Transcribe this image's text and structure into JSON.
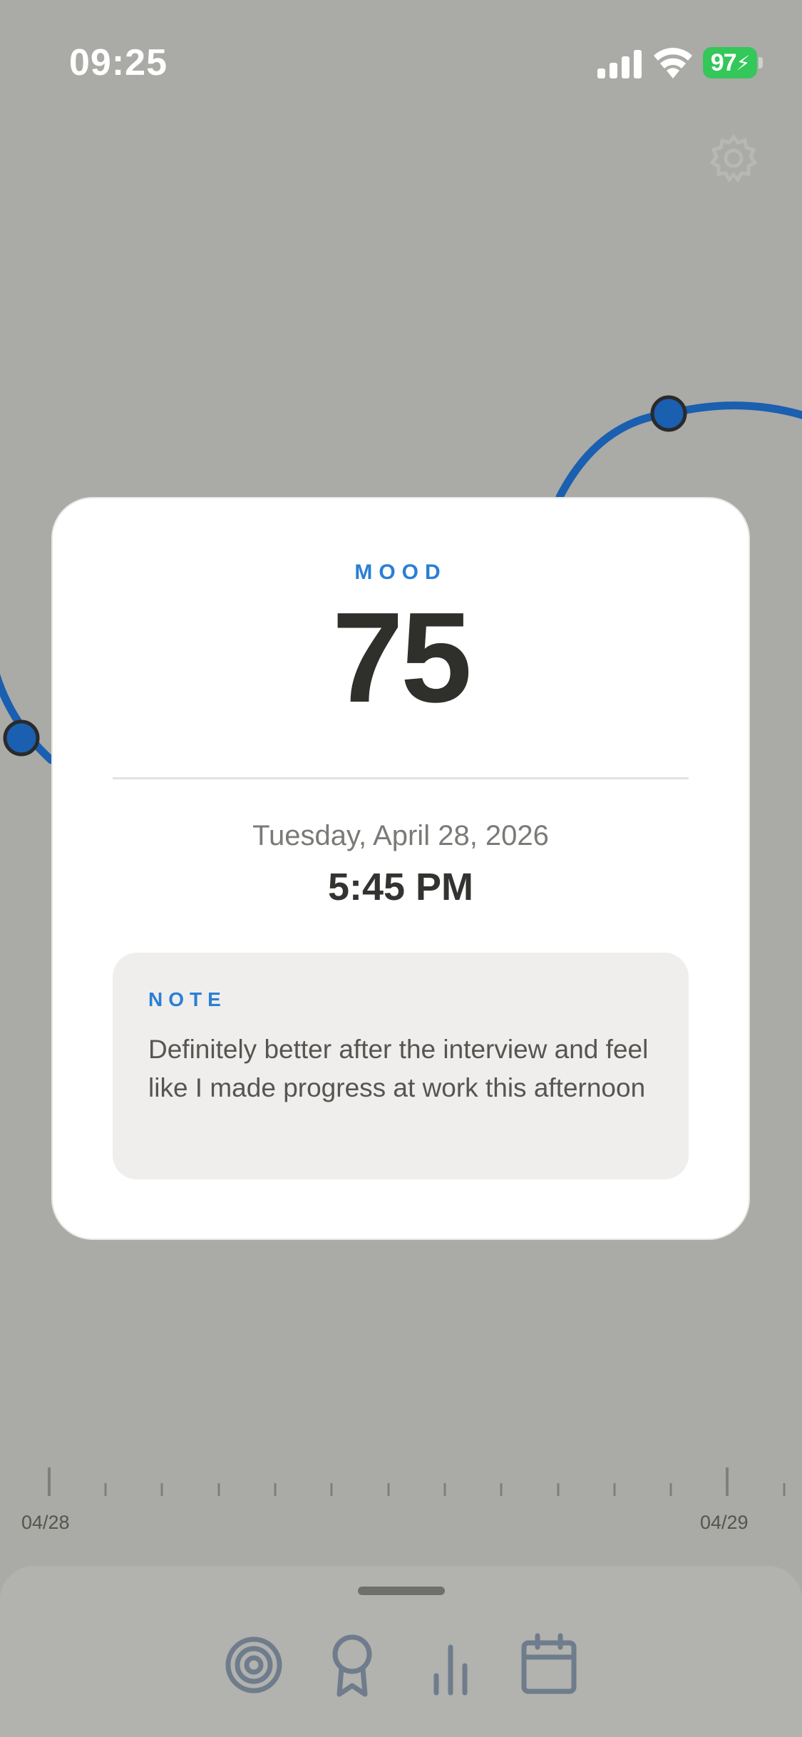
{
  "status_bar": {
    "time": "09:25",
    "battery": "97",
    "icons": [
      "signal-bars-icon",
      "wifi-icon",
      "battery-charging-icon"
    ]
  },
  "header": {
    "settings_icon": "gear-icon"
  },
  "chart_data": {
    "type": "line",
    "series": [
      {
        "values_visible_left": "partial",
        "points_shown": 2
      }
    ],
    "x_tick_labels": [
      "04/28",
      "04/29"
    ],
    "line_color": "#1a5fb0"
  },
  "mood_card": {
    "label": "MOOD",
    "value": "75",
    "date": "Tuesday, April 28, 2026",
    "time": "5:45 PM",
    "note": {
      "label": "NOTE",
      "text": "Definitely better after the interview and feel like I made progress at work this afternoon"
    }
  },
  "timeline": {
    "start_label": "04/28",
    "end_label": "04/29"
  },
  "tab_bar": {
    "tabs": [
      {
        "icon": "target-icon"
      },
      {
        "icon": "award-ribbon-icon"
      },
      {
        "icon": "bar-chart-icon"
      },
      {
        "icon": "calendar-icon"
      }
    ]
  },
  "colors": {
    "accent": "#2a7fd4",
    "line": "#1a5fb0",
    "overlay_background": "#aaaaa6",
    "battery": "#34c759"
  }
}
